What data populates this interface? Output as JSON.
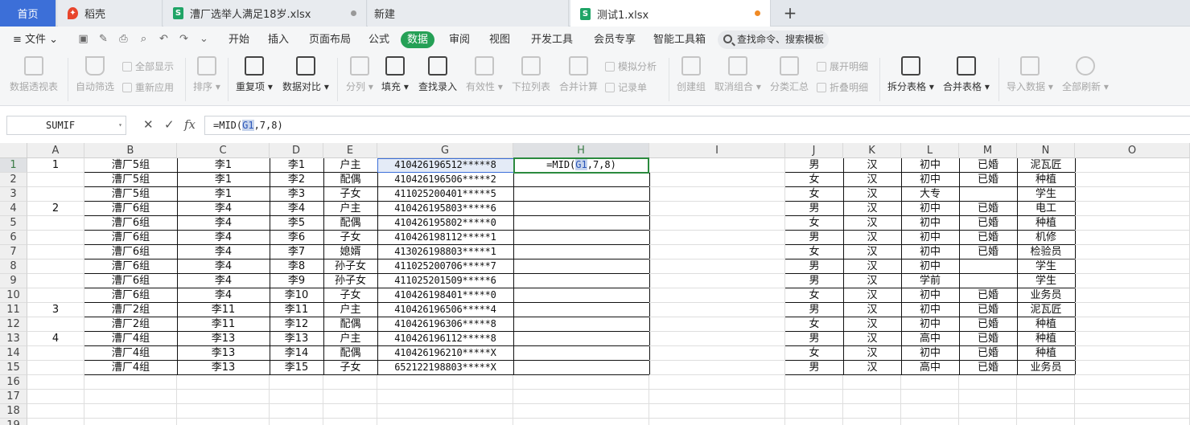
{
  "tabs": {
    "home": "首页",
    "daoke": "稻壳",
    "file1": "漕厂选举人满足18岁.xlsx",
    "new": "新建",
    "file2": "测试1.xlsx",
    "add": "+"
  },
  "menu": {
    "file": "文件",
    "items": [
      "开始",
      "插入",
      "页面布局",
      "公式",
      "数据",
      "审阅",
      "视图",
      "开发工具",
      "会员专享",
      "智能工具箱"
    ],
    "active_index": 4,
    "search": "查找命令、搜索模板"
  },
  "ribbon": {
    "pivot": "数据透视表",
    "autofilter": "自动筛选",
    "showall": "全部显示",
    "reapply": "重新应用",
    "sort": "排序",
    "dup": "重复项",
    "compare": "数据对比",
    "split": "分列",
    "fill": "填充",
    "findentry": "查找录入",
    "validity": "有效性",
    "droplist": "下拉列表",
    "consolidate": "合并计算",
    "simulate": "模拟分析",
    "record": "记录单",
    "group": "创建组",
    "ungroup": "取消组合",
    "subtotal": "分类汇总",
    "expand": "展开明细",
    "collapse": "折叠明细",
    "splittable": "拆分表格",
    "mergetable": "合并表格",
    "import": "导入数据",
    "refresh": "全部刷新"
  },
  "formula_bar": {
    "name_box": "SUMIF",
    "cancel": "✕",
    "confirm": "✓",
    "fx": "fx",
    "pre": "=MID(",
    "ref": "G1",
    "post": ",7,8)"
  },
  "columns": [
    "A",
    "B",
    "C",
    "D",
    "E",
    "G",
    "H",
    "I",
    "J",
    "K",
    "L",
    "M",
    "N",
    "O"
  ],
  "rows": [
    {
      "n": "1",
      "A": "1",
      "B": "漕厂5组",
      "C": "李1",
      "D": "李1",
      "E": "户主",
      "G": "410426196512*****8",
      "H": "",
      "J": "男",
      "K": "汉",
      "L": "初中",
      "M": "已婚",
      "N": "泥瓦匠"
    },
    {
      "n": "2",
      "A": "",
      "B": "漕厂5组",
      "C": "李1",
      "D": "李2",
      "E": "配偶",
      "G": "410426196506*****2",
      "H": "",
      "J": "女",
      "K": "汉",
      "L": "初中",
      "M": "已婚",
      "N": "种植"
    },
    {
      "n": "3",
      "A": "",
      "B": "漕厂5组",
      "C": "李1",
      "D": "李3",
      "E": "子女",
      "G": "411025200401*****5",
      "H": "",
      "J": "女",
      "K": "汉",
      "L": "大专",
      "M": "",
      "N": "学生"
    },
    {
      "n": "4",
      "A": "2",
      "B": "漕厂6组",
      "C": "李4",
      "D": "李4",
      "E": "户主",
      "G": "410426195803*****6",
      "H": "",
      "J": "男",
      "K": "汉",
      "L": "初中",
      "M": "已婚",
      "N": "电工"
    },
    {
      "n": "5",
      "A": "",
      "B": "漕厂6组",
      "C": "李4",
      "D": "李5",
      "E": "配偶",
      "G": "410426195802*****0",
      "H": "",
      "J": "女",
      "K": "汉",
      "L": "初中",
      "M": "已婚",
      "N": "种植"
    },
    {
      "n": "6",
      "A": "",
      "B": "漕厂6组",
      "C": "李4",
      "D": "李6",
      "E": "子女",
      "G": "410426198112*****1",
      "H": "",
      "J": "男",
      "K": "汉",
      "L": "初中",
      "M": "已婚",
      "N": "机修"
    },
    {
      "n": "7",
      "A": "",
      "B": "漕厂6组",
      "C": "李4",
      "D": "李7",
      "E": "媳婿",
      "G": "413026198803*****1",
      "H": "",
      "J": "女",
      "K": "汉",
      "L": "初中",
      "M": "已婚",
      "N": "检验员"
    },
    {
      "n": "8",
      "A": "",
      "B": "漕厂6组",
      "C": "李4",
      "D": "李8",
      "E": "孙子女",
      "G": "411025200706*****7",
      "H": "",
      "J": "男",
      "K": "汉",
      "L": "初中",
      "M": "",
      "N": "学生"
    },
    {
      "n": "9",
      "A": "",
      "B": "漕厂6组",
      "C": "李4",
      "D": "李9",
      "E": "孙子女",
      "G": "411025201509*****6",
      "H": "",
      "J": "男",
      "K": "汉",
      "L": "学前",
      "M": "",
      "N": "学生"
    },
    {
      "n": "10",
      "A": "",
      "B": "漕厂6组",
      "C": "李4",
      "D": "李10",
      "E": "子女",
      "G": "410426198401*****0",
      "H": "",
      "J": "女",
      "K": "汉",
      "L": "初中",
      "M": "已婚",
      "N": "业务员"
    },
    {
      "n": "11",
      "A": "3",
      "B": "漕厂2组",
      "C": "李11",
      "D": "李11",
      "E": "户主",
      "G": "410426196506*****4",
      "H": "",
      "J": "男",
      "K": "汉",
      "L": "初中",
      "M": "已婚",
      "N": "泥瓦匠"
    },
    {
      "n": "12",
      "A": "",
      "B": "漕厂2组",
      "C": "李11",
      "D": "李12",
      "E": "配偶",
      "G": "410426196306*****8",
      "H": "",
      "J": "女",
      "K": "汉",
      "L": "初中",
      "M": "已婚",
      "N": "种植"
    },
    {
      "n": "13",
      "A": "4",
      "B": "漕厂4组",
      "C": "李13",
      "D": "李13",
      "E": "户主",
      "G": "410426196112*****8",
      "H": "",
      "J": "男",
      "K": "汉",
      "L": "高中",
      "M": "已婚",
      "N": "种植"
    },
    {
      "n": "14",
      "A": "",
      "B": "漕厂4组",
      "C": "李13",
      "D": "李14",
      "E": "配偶",
      "G": "410426196210*****X",
      "H": "",
      "J": "女",
      "K": "汉",
      "L": "初中",
      "M": "已婚",
      "N": "种植"
    },
    {
      "n": "15",
      "A": "",
      "B": "漕厂4组",
      "C": "李13",
      "D": "李15",
      "E": "子女",
      "G": "652122198803*****X",
      "H": "",
      "J": "男",
      "K": "汉",
      "L": "高中",
      "M": "已婚",
      "N": "业务员"
    }
  ],
  "empty_rows": [
    "16",
    "17",
    "18",
    "19"
  ],
  "active_cell_text": {
    "pre": "=MID(",
    "ref": "G1",
    "post": ",7,8)"
  },
  "colors": {
    "accent": "#25a056",
    "home_tab": "#3c6fd8",
    "selection": "#2b8a3e"
  }
}
